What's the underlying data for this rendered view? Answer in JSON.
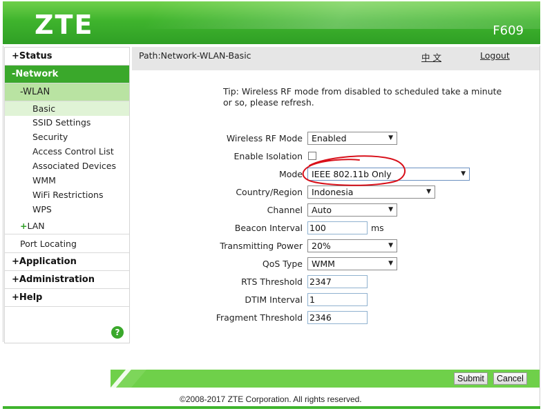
{
  "header": {
    "logo": "ZTE",
    "model": "F609"
  },
  "sidebar": {
    "status": "Status",
    "network": "-Network",
    "wlan": "-WLAN",
    "wlan_items": [
      "Basic",
      "SSID Settings",
      "Security",
      "Access Control List",
      "Associated Devices",
      "WMM",
      "WiFi Restrictions",
      "WPS"
    ],
    "lan": "LAN",
    "port_locating": "Port Locating",
    "application": "Application",
    "administration": "Administration",
    "help": "Help",
    "help_icon": "?"
  },
  "pathbar": {
    "path": "Path:Network-WLAN-Basic",
    "language": "中 文",
    "logout": "Logout"
  },
  "tip": "Tip: Wireless RF mode from disabled to scheduled take a minute or so, please refresh.",
  "form": {
    "wireless_rf_mode": {
      "label": "Wireless RF Mode",
      "value": "Enabled"
    },
    "enable_isolation": {
      "label": "Enable Isolation",
      "checked": false
    },
    "mode": {
      "label": "Mode",
      "value": "IEEE 802.11b Only"
    },
    "country_region": {
      "label": "Country/Region",
      "value": "Indonesia"
    },
    "channel": {
      "label": "Channel",
      "value": "Auto"
    },
    "beacon_interval": {
      "label": "Beacon Interval",
      "value": "100",
      "unit": "ms"
    },
    "transmitting_power": {
      "label": "Transmitting Power",
      "value": "20%"
    },
    "qos_type": {
      "label": "QoS Type",
      "value": "WMM"
    },
    "rts_threshold": {
      "label": "RTS Threshold",
      "value": "2347"
    },
    "dtim_interval": {
      "label": "DTIM Interval",
      "value": "1"
    },
    "fragment_threshold": {
      "label": "Fragment Threshold",
      "value": "2346"
    }
  },
  "buttons": {
    "submit": "Submit",
    "cancel": "Cancel"
  },
  "footer": "©2008-2017 ZTE Corporation. All rights reserved.",
  "colors": {
    "brand_green": "#3fb42d",
    "active_menu": "#3aa82b",
    "annotation_red": "#d8101a"
  },
  "icons": {
    "dropdown": "chevron-down-icon",
    "help": "help-icon"
  }
}
